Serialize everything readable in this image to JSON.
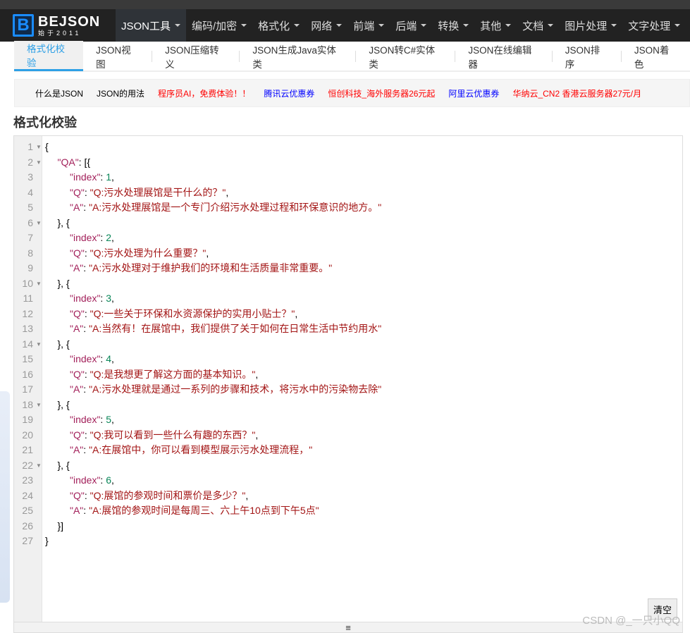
{
  "logo": {
    "name": "BEJSON",
    "sub": "始于2011",
    "mark": "B"
  },
  "nav": [
    {
      "label": "JSON工具",
      "active": true
    },
    {
      "label": "编码/加密"
    },
    {
      "label": "格式化"
    },
    {
      "label": "网络"
    },
    {
      "label": "前端"
    },
    {
      "label": "后端"
    },
    {
      "label": "转换"
    },
    {
      "label": "其他"
    },
    {
      "label": "文档"
    },
    {
      "label": "图片处理"
    },
    {
      "label": "文字处理"
    }
  ],
  "tabs": [
    {
      "label": "格式化校验",
      "active": true
    },
    {
      "label": "JSON视图"
    },
    {
      "label": "JSON压缩转义"
    },
    {
      "label": "JSON生成Java实体类"
    },
    {
      "label": "JSON转C#实体类"
    },
    {
      "label": "JSON在线编辑器"
    },
    {
      "label": "JSON排序"
    },
    {
      "label": "JSON着色"
    }
  ],
  "links": [
    {
      "label": "什么是JSON",
      "color": "#000000"
    },
    {
      "label": "JSON的用法",
      "color": "#000000"
    },
    {
      "label": "程序员AI，免费体验！！",
      "color": "#ff0000"
    },
    {
      "label": "腾讯云优惠券",
      "color": "#0000ff"
    },
    {
      "label": "恒创科技_海外服务器26元起",
      "color": "#ff0000"
    },
    {
      "label": "阿里云优惠券",
      "color": "#0000ff"
    },
    {
      "label": "华纳云_CN2 香港云服务器27元/月",
      "color": "#ff0000"
    }
  ],
  "page_title": "格式化校验",
  "editor": {
    "lines": [
      {
        "fold": true,
        "indent": 0,
        "tokens": [
          [
            "p",
            "{"
          ]
        ]
      },
      {
        "fold": true,
        "indent": 1,
        "tokens": [
          [
            "k",
            "\"QA\""
          ],
          [
            "p",
            ": [{"
          ]
        ]
      },
      {
        "indent": 2,
        "tokens": [
          [
            "k",
            "\"index\""
          ],
          [
            "p",
            ": "
          ],
          [
            "n",
            "1"
          ],
          [
            "p",
            ","
          ]
        ]
      },
      {
        "indent": 2,
        "tokens": [
          [
            "k",
            "\"Q\""
          ],
          [
            "p",
            ": "
          ],
          [
            "s",
            "\"Q:污水处理展馆是干什么的？\""
          ],
          [
            "p",
            ","
          ]
        ]
      },
      {
        "indent": 2,
        "tokens": [
          [
            "k",
            "\"A\""
          ],
          [
            "p",
            ": "
          ],
          [
            "s",
            "\"A:污水处理展馆是一个专门介绍污水处理过程和环保意识的地方。\""
          ]
        ]
      },
      {
        "fold": true,
        "indent": 1,
        "tokens": [
          [
            "p",
            "}, {"
          ]
        ]
      },
      {
        "indent": 2,
        "tokens": [
          [
            "k",
            "\"index\""
          ],
          [
            "p",
            ": "
          ],
          [
            "n",
            "2"
          ],
          [
            "p",
            ","
          ]
        ]
      },
      {
        "indent": 2,
        "tokens": [
          [
            "k",
            "\"Q\""
          ],
          [
            "p",
            ": "
          ],
          [
            "s",
            "\"Q:污水处理为什么重要？\""
          ],
          [
            "p",
            ","
          ]
        ]
      },
      {
        "indent": 2,
        "tokens": [
          [
            "k",
            "\"A\""
          ],
          [
            "p",
            ": "
          ],
          [
            "s",
            "\"A:污水处理对于维护我们的环境和生活质量非常重要。\""
          ]
        ]
      },
      {
        "fold": true,
        "indent": 1,
        "tokens": [
          [
            "p",
            "}, {"
          ]
        ]
      },
      {
        "indent": 2,
        "tokens": [
          [
            "k",
            "\"index\""
          ],
          [
            "p",
            ": "
          ],
          [
            "n",
            "3"
          ],
          [
            "p",
            ","
          ]
        ]
      },
      {
        "indent": 2,
        "tokens": [
          [
            "k",
            "\"Q\""
          ],
          [
            "p",
            ": "
          ],
          [
            "s",
            "\"Q:一些关于环保和水资源保护的实用小贴士？\""
          ],
          [
            "p",
            ","
          ]
        ]
      },
      {
        "indent": 2,
        "tokens": [
          [
            "k",
            "\"A\""
          ],
          [
            "p",
            ": "
          ],
          [
            "s",
            "\"A:当然有！在展馆中，我们提供了关于如何在日常生活中节约用水\""
          ]
        ]
      },
      {
        "fold": true,
        "indent": 1,
        "tokens": [
          [
            "p",
            "}, {"
          ]
        ]
      },
      {
        "indent": 2,
        "tokens": [
          [
            "k",
            "\"index\""
          ],
          [
            "p",
            ": "
          ],
          [
            "n",
            "4"
          ],
          [
            "p",
            ","
          ]
        ]
      },
      {
        "indent": 2,
        "tokens": [
          [
            "k",
            "\"Q\""
          ],
          [
            "p",
            ": "
          ],
          [
            "s",
            "\"Q:是我想更了解这方面的基本知识。\""
          ],
          [
            "p",
            ","
          ]
        ]
      },
      {
        "indent": 2,
        "tokens": [
          [
            "k",
            "\"A\""
          ],
          [
            "p",
            ": "
          ],
          [
            "s",
            "\"A:污水处理就是通过一系列的步骤和技术，将污水中的污染物去除\""
          ]
        ]
      },
      {
        "fold": true,
        "indent": 1,
        "tokens": [
          [
            "p",
            "}, {"
          ]
        ]
      },
      {
        "indent": 2,
        "tokens": [
          [
            "k",
            "\"index\""
          ],
          [
            "p",
            ": "
          ],
          [
            "n",
            "5"
          ],
          [
            "p",
            ","
          ]
        ]
      },
      {
        "indent": 2,
        "tokens": [
          [
            "k",
            "\"Q\""
          ],
          [
            "p",
            ": "
          ],
          [
            "s",
            "\"Q:我可以看到一些什么有趣的东西？\""
          ],
          [
            "p",
            ","
          ]
        ]
      },
      {
        "indent": 2,
        "tokens": [
          [
            "k",
            "\"A\""
          ],
          [
            "p",
            ": "
          ],
          [
            "s",
            "\"A:在展馆中，你可以看到模型展示污水处理流程，\""
          ]
        ]
      },
      {
        "fold": true,
        "indent": 1,
        "tokens": [
          [
            "p",
            "}, {"
          ]
        ]
      },
      {
        "indent": 2,
        "tokens": [
          [
            "k",
            "\"index\""
          ],
          [
            "p",
            ": "
          ],
          [
            "n",
            "6"
          ],
          [
            "p",
            ","
          ]
        ]
      },
      {
        "indent": 2,
        "tokens": [
          [
            "k",
            "\"Q\""
          ],
          [
            "p",
            ": "
          ],
          [
            "s",
            "\"Q:展馆的参观时间和票价是多少？\""
          ],
          [
            "p",
            ","
          ]
        ]
      },
      {
        "indent": 2,
        "tokens": [
          [
            "k",
            "\"A\""
          ],
          [
            "p",
            ": "
          ],
          [
            "s",
            "\"A:展馆的参观时间是每周三、六上午10点到下午5点\""
          ]
        ]
      },
      {
        "indent": 1,
        "tokens": [
          [
            "p",
            "}]"
          ]
        ]
      },
      {
        "indent": 0,
        "tokens": [
          [
            "p",
            "}"
          ]
        ]
      }
    ],
    "clear_label": "清空",
    "resize_handle": "≡"
  },
  "watermark": "CSDN @_一只小QQ"
}
